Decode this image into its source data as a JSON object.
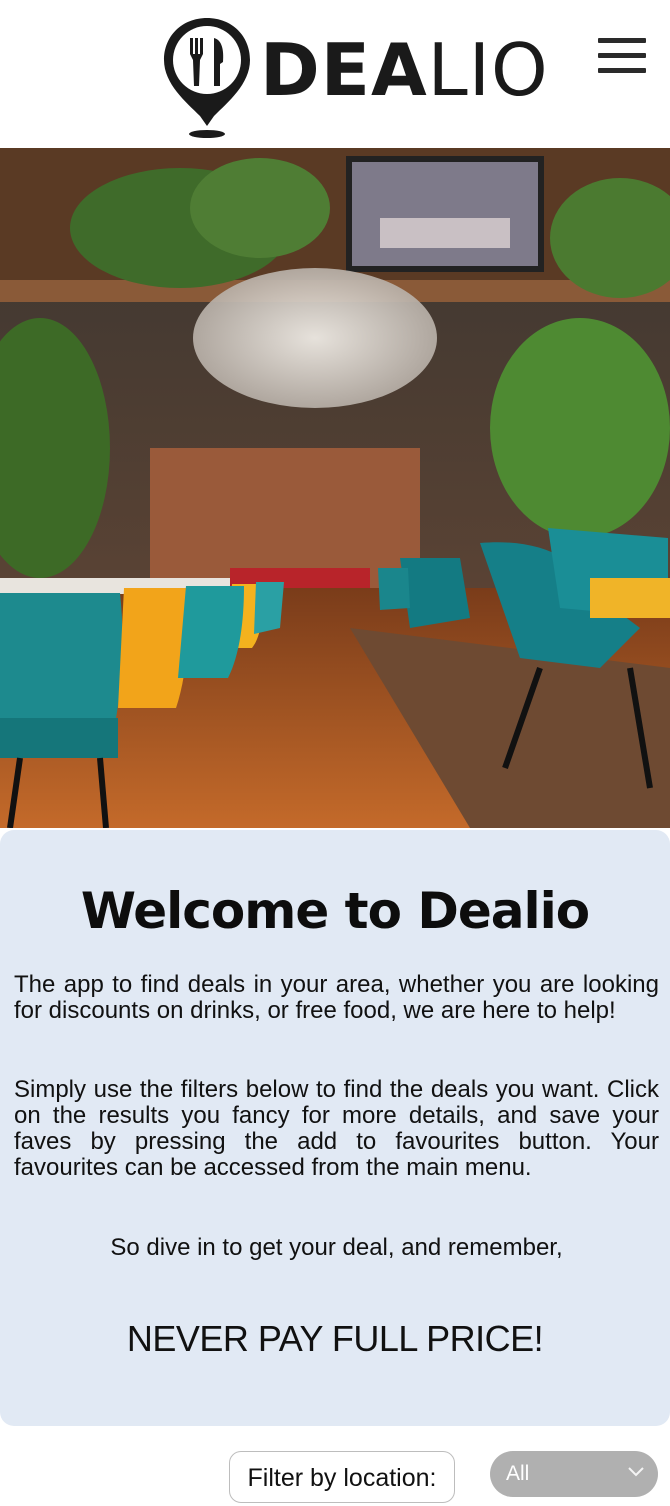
{
  "header": {
    "logo_text_bold": "DEA",
    "logo_text_light": "LIO",
    "logo_icon": "fork-knife-pin-icon",
    "menu_icon": "hamburger-menu-icon"
  },
  "hero": {
    "image": "restaurant-interior-photo"
  },
  "welcome": {
    "title": "Welcome to Dealio",
    "paragraph_1": "The app to find deals in your area, whether you are looking for discounts on drinks, or free food, we are here to help!",
    "paragraph_2": "Simply use the filters below to find the deals you want. Click on the results you fancy for more details, and save your faves by pressing the add to favourites button. Your favourites can be accessed from the main menu.",
    "paragraph_3": "So dive in to get your deal, and remember,",
    "slogan": "NEVER PAY FULL PRICE!"
  },
  "filter": {
    "label": "Filter by location:",
    "selected": "All",
    "chevron_icon": "chevron-down-icon"
  },
  "colors": {
    "card_bg": "#e1e9f4",
    "select_bg": "#b0b0b0",
    "logo_dark": "#1a1a1a"
  }
}
